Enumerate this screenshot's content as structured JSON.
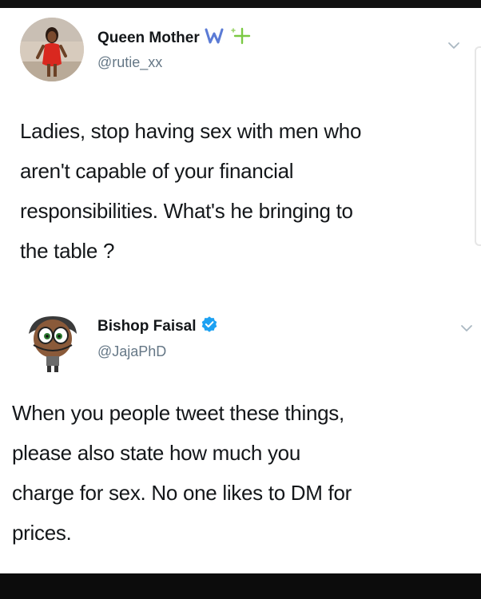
{
  "tweets": [
    {
      "display_name": "Queen Mother",
      "handle": "@rutie_xx",
      "name_badges": [
        "w-emoji-icon",
        "sparkle-icon"
      ],
      "body_lines": [
        "Ladies, stop having sex with men who",
        "aren't capable of your financial",
        "responsibilities. What's he bringing to",
        "the table ?"
      ]
    },
    {
      "display_name": "Bishop Faisal",
      "handle": "@JajaPhD",
      "name_badges": [
        "verified-badge-icon"
      ],
      "body_lines": [
        "When you people tweet these things,",
        "please also state how much you",
        "charge for sex. No one likes to DM for",
        "prices."
      ]
    }
  ],
  "colors": {
    "text": "#14171a",
    "handle": "#657786",
    "verified": "#1da1f2",
    "w_emoji": "#5b7bd5",
    "sparkle": "#7ac943"
  }
}
